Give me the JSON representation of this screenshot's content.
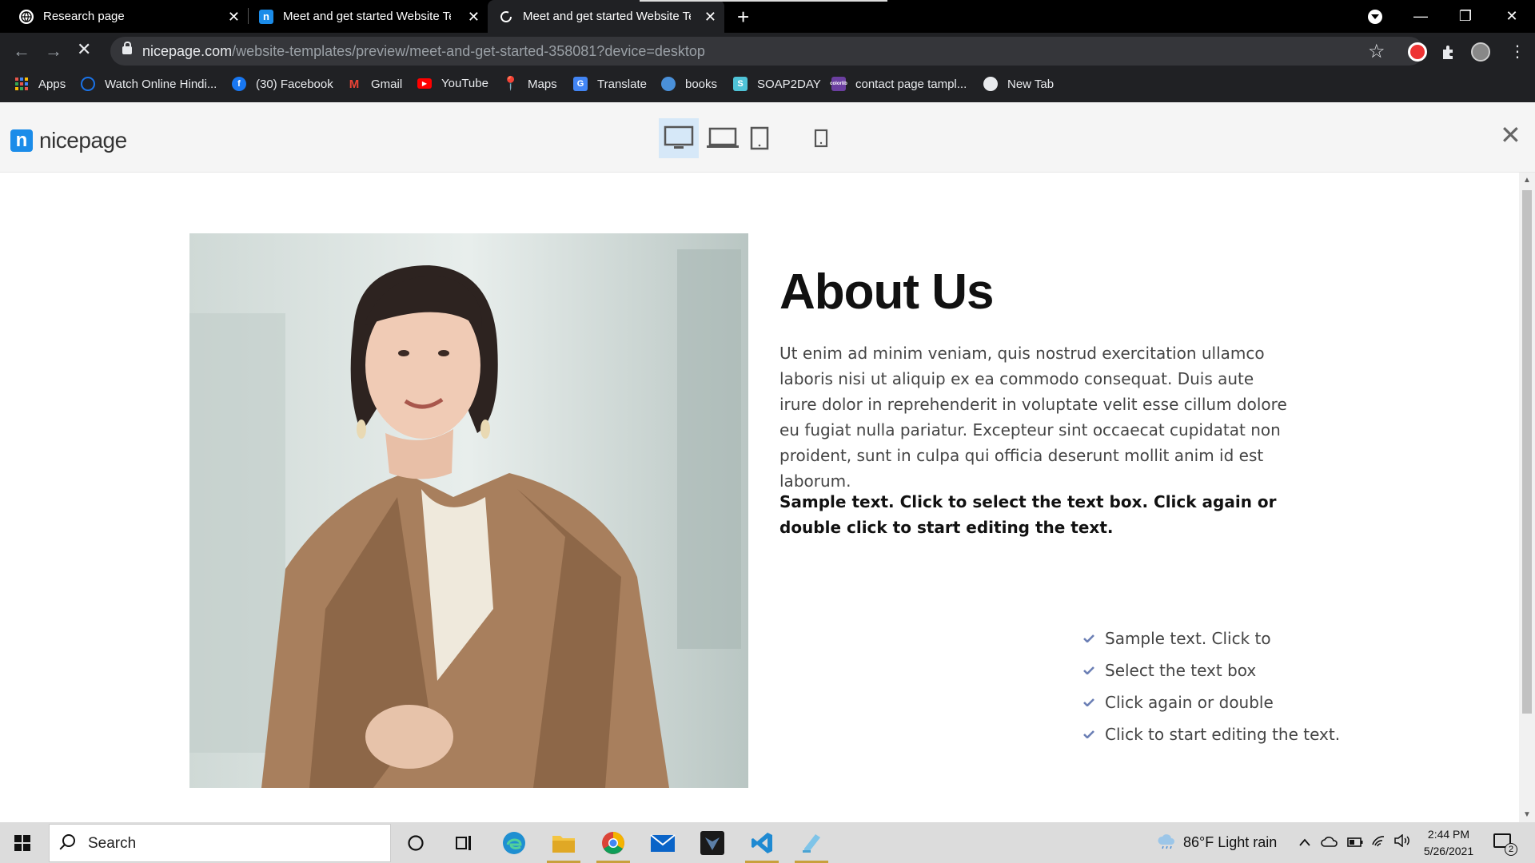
{
  "browser": {
    "tabs": [
      {
        "title": "Research page",
        "icon": "globe-icon"
      },
      {
        "title": "Meet and get started Website Te",
        "icon": "nicepage-icon"
      },
      {
        "title": "Meet and get started Website Te",
        "icon": "loading-icon"
      }
    ],
    "url_host": "nicepage.com",
    "url_path": "/website-templates/preview/meet-and-get-started-358081?device=desktop",
    "bookmarks": [
      "Apps",
      "Watch Online Hindi...",
      "(30) Facebook",
      "Gmail",
      "YouTube",
      "Maps",
      "Translate",
      "books",
      "SOAP2DAY",
      "contact page tampl...",
      "New Tab"
    ]
  },
  "preview_header": {
    "logo": "nicepage",
    "devices": [
      "desktop",
      "laptop",
      "tablet",
      "phone"
    ],
    "active_device": "desktop"
  },
  "content": {
    "title": "About Us",
    "paragraph": "Ut enim ad minim veniam, quis nostrud exercitation ullamco laboris nisi ut aliquip ex ea commodo consequat. Duis aute irure dolor in reprehenderit in voluptate velit esse cillum dolore eu fugiat nulla pariatur. Excepteur sint occaecat cupidatat non proident, sunt in culpa qui officia deserunt mollit anim id est laborum.",
    "bold_text": "Sample text. Click to select the text box. Click again or double click to start editing the text.",
    "list": [
      "Sample text. Click to",
      "Select the text box",
      "Click again or double",
      "Click to start editing the text."
    ]
  },
  "taskbar": {
    "search": "Search",
    "weather": "86°F  Light rain",
    "time": "2:44 PM",
    "date": "5/26/2021",
    "notifications": "2"
  },
  "colors": {
    "accent": "#1b8ce9",
    "check": "#6b7fb5",
    "chrome_dark": "#202124"
  }
}
